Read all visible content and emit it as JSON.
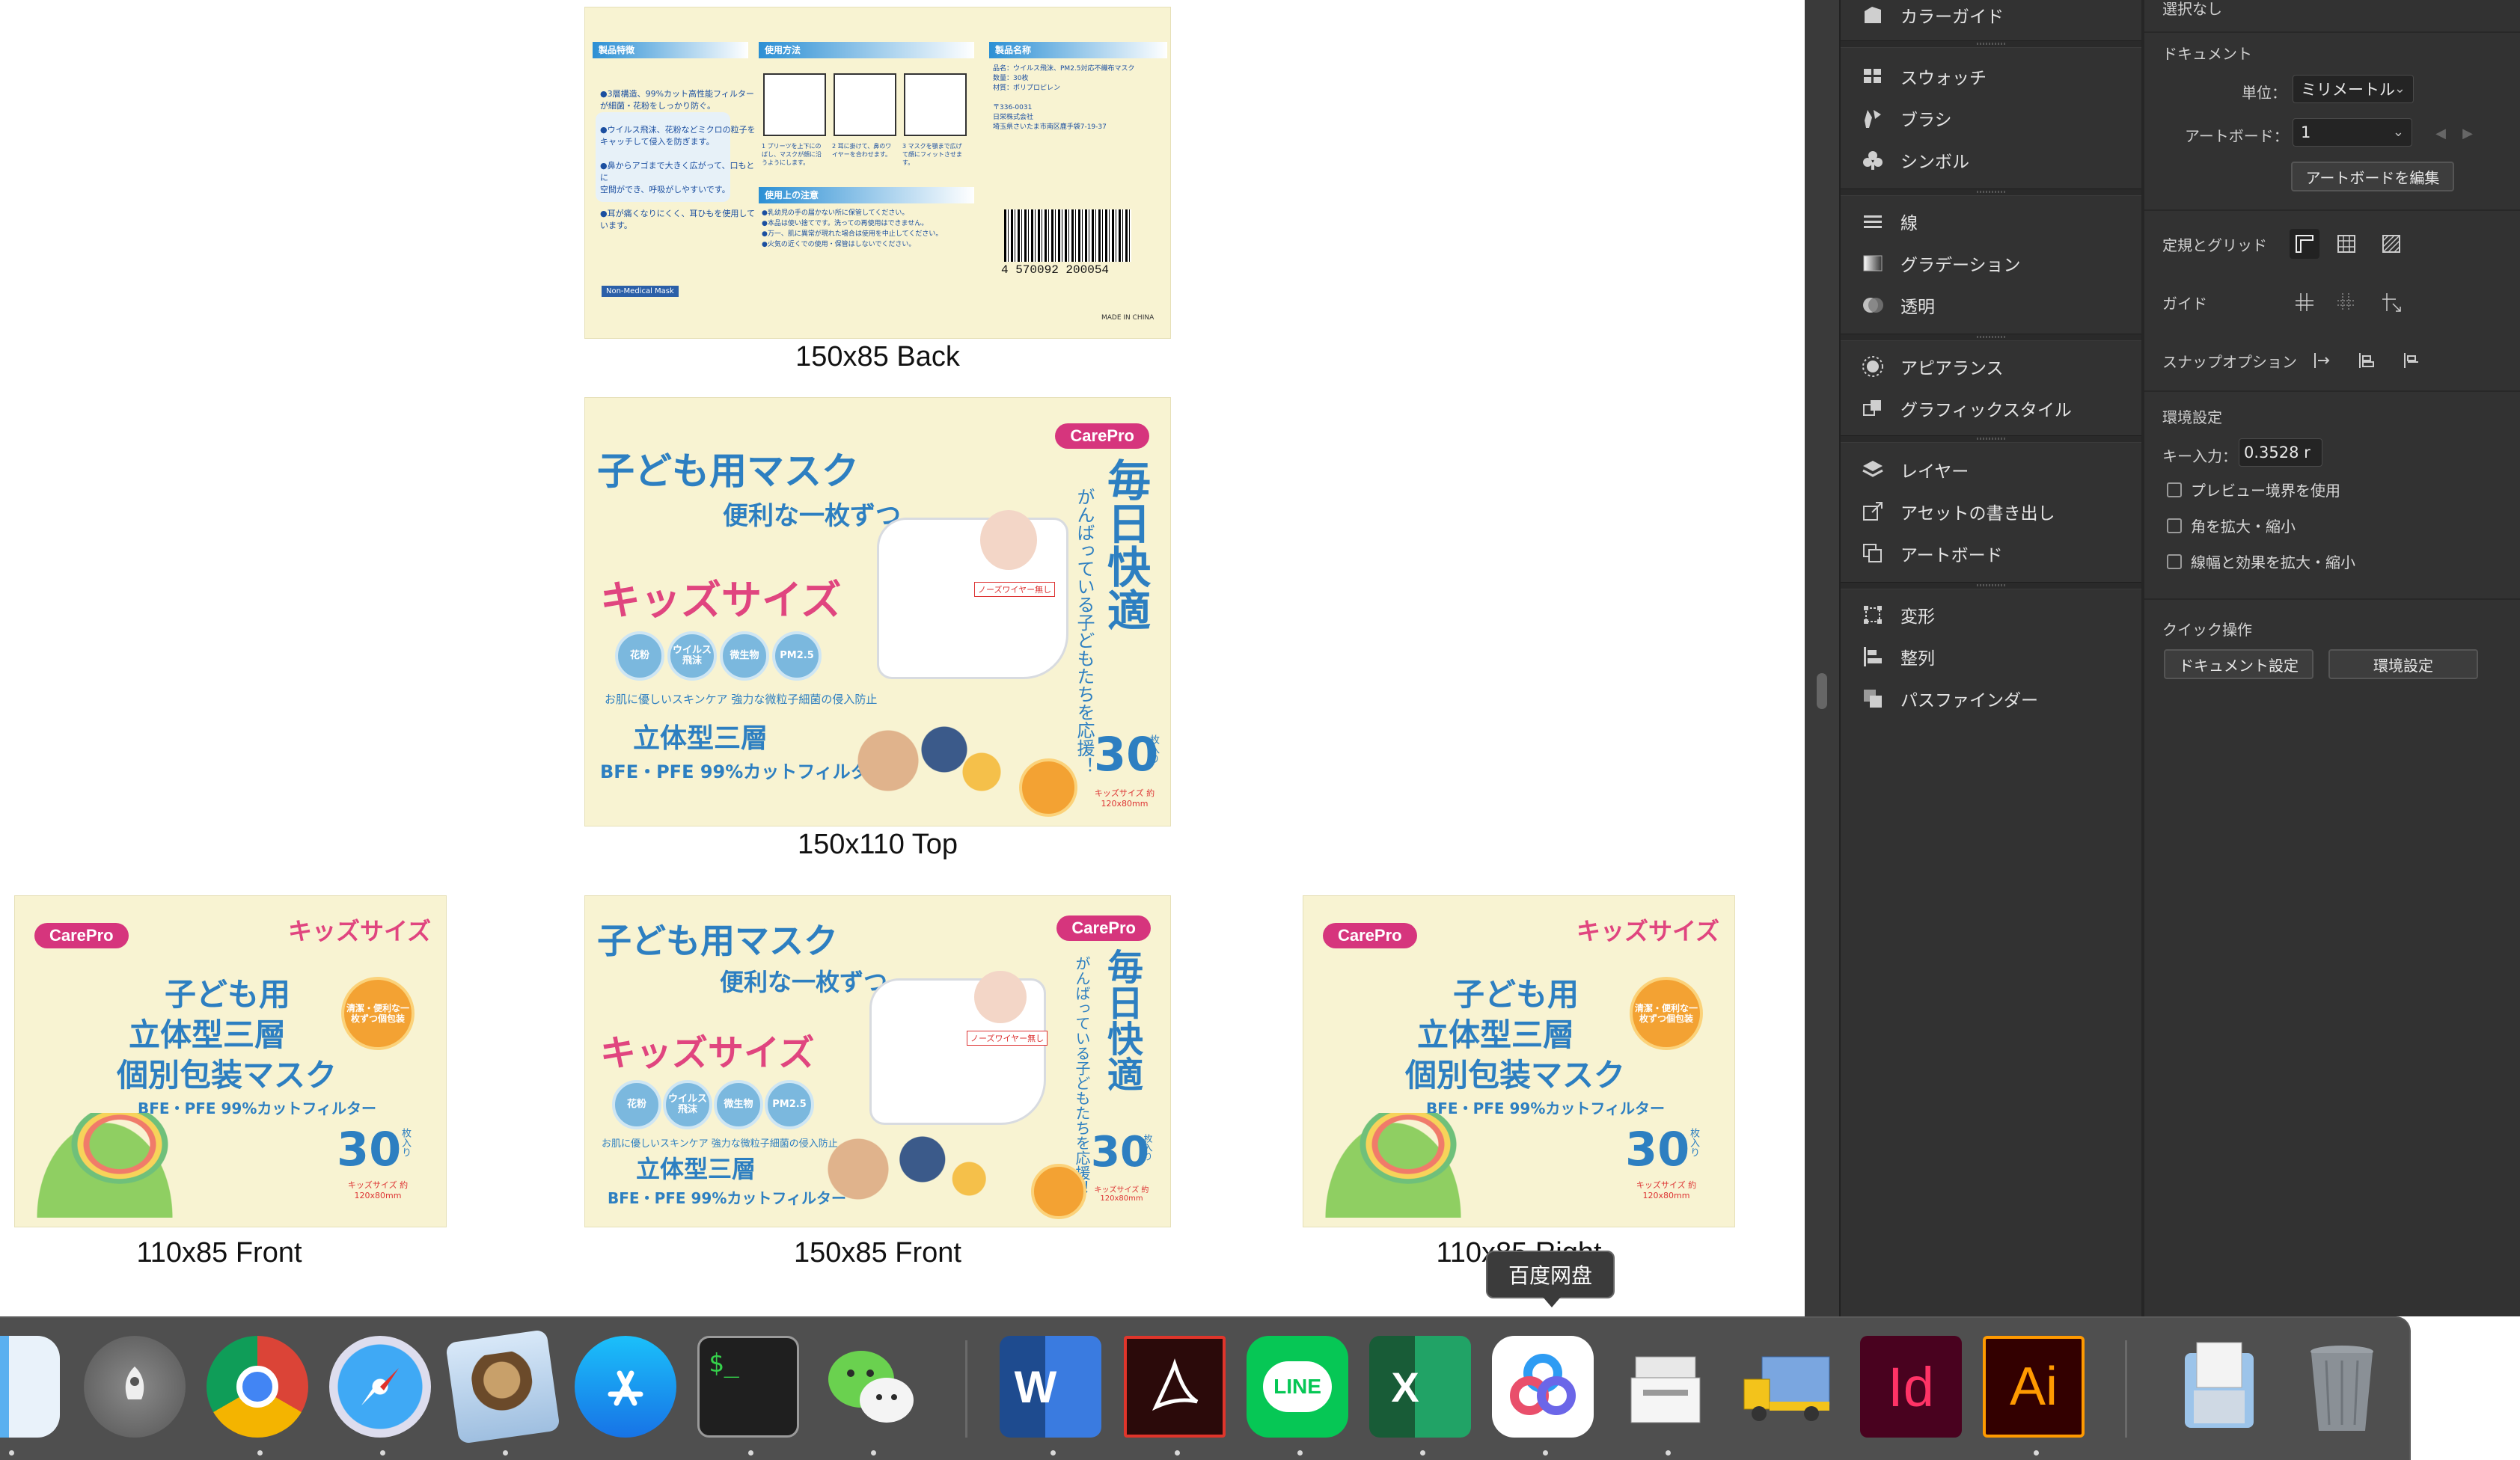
{
  "artboards": {
    "back": {
      "caption": "150x85 Back",
      "headers": [
        "製品特徴",
        "使用方法",
        "製品名称",
        "使用上の注意"
      ],
      "feature_text": "●3層構造、99%カット高性能フィルター\nが細菌・花粉をしっかり防ぐ。\n\n●ウイルス飛沫、花粉などミクロの粒子を\nキャッチして侵入を防ぎます。\n\n●鼻からアゴまで大きく広がって、口もとに\n空間ができ、呼吸がしやすいです。\n\n●耳が痛くなりにくく、耳ひもを使用して\nいます。",
      "usage_steps": [
        "1 プリーツを上下にのばし、マスクが顔に沿うようにします。",
        "2 耳に掛けて、鼻のワイヤーを合わせます。",
        "3 マスクを顎まで広げて顔にフィットさせます。"
      ],
      "product_info": "品名：ウイルス飛沫、PM2.5対応不織布マスク\n数量：30枚\n材質：ポリプロピレン\n\n〒336-0031\n日栄株式会社\n埼玉県さいたま市南区鹿手袋7-19-37",
      "caution_text": "●乳幼児の手の届かない所に保管してください。\n●本品は使い捨てです。洗っての再使用はできません。\n●万一、肌に異常が現れた場合は使用を中止してください。\n●火気の近くでの使用・保管はしないでください。",
      "barcode_number": "4 570092 200054",
      "made_in": "MADE IN CHINA",
      "tag": "Non-Medical Mask"
    },
    "top": {
      "caption": "150x110 Top",
      "brand": "CarePro",
      "title": "子ども用マスク",
      "subtitle": "便利な一枚ずつ",
      "kids_size": "キッズサイズ",
      "badges": [
        "花粉",
        "ウイルス飛沫",
        "微生物",
        "PM2.5"
      ],
      "skin_text": "お肌に優しいスキンケア 強力な微粒子細菌の侵入防止",
      "three_layer": "立体型三層",
      "filter_text": "BFE・PFE 99%カットフィルター",
      "vertical_title": "毎日快適",
      "vertical_sub": "がんばっている子どもたちを応援！",
      "count": "30",
      "count_unit": "枚入り",
      "size_note": "キッズサイズ 約120x80mm",
      "wire_note": "ノーズワイヤー無し"
    },
    "front110": {
      "caption": "110x85 Front",
      "brand": "CarePro",
      "kids_size": "キッズサイズ",
      "line1": "子ども用",
      "line2": "立体型三層",
      "line3": "個別包装マスク",
      "filter_text": "BFE・PFE 99%カットフィルター",
      "count": "30",
      "count_unit": "枚入り",
      "size_note": "キッズサイズ 約120x80mm",
      "badge_text": "清潔・便利な一枚ずつ個包装"
    },
    "front150": {
      "caption": "150x85 Front",
      "brand": "CarePro",
      "title": "子ども用マスク",
      "subtitle": "便利な一枚ずつ",
      "kids_size": "キッズサイズ",
      "badges": [
        "花粉",
        "ウイルス飛沫",
        "微生物",
        "PM2.5"
      ],
      "skin_text": "お肌に優しいスキンケア 強力な微粒子細菌の侵入防止",
      "three_layer": "立体型三層",
      "filter_text": "BFE・PFE 99%カットフィルター",
      "vertical_title": "毎日快適",
      "vertical_sub": "がんばっている子どもたちを応援！",
      "count": "30",
      "count_unit": "枚入り",
      "size_note": "キッズサイズ 約120x80mm",
      "wire_note": "ノーズワイヤー無し"
    },
    "right110": {
      "caption": "110x85 Right",
      "brand": "CarePro",
      "kids_size": "キッズサイズ",
      "line1": "子ども用",
      "line2": "立体型三層",
      "line3": "個別包装マスク",
      "filter_text": "BFE・PFE 99%カットフィルター",
      "count": "30",
      "count_unit": "枚入り",
      "size_note": "キッズサイズ 約120x80mm",
      "badge_text": "清潔・便利な一枚ずつ個包装"
    }
  },
  "panel_list": {
    "items": [
      {
        "label": "カラーガイド",
        "icon": "color-guide-icon"
      },
      {
        "label": "スウォッチ",
        "icon": "swatches-icon"
      },
      {
        "label": "ブラシ",
        "icon": "brushes-icon"
      },
      {
        "label": "シンボル",
        "icon": "symbols-icon"
      },
      {
        "label": "線",
        "icon": "stroke-icon"
      },
      {
        "label": "グラデーション",
        "icon": "gradient-icon"
      },
      {
        "label": "透明",
        "icon": "transparency-icon"
      },
      {
        "label": "アピアランス",
        "icon": "appearance-icon"
      },
      {
        "label": "グラフィックスタイル",
        "icon": "graphic-styles-icon"
      },
      {
        "label": "レイヤー",
        "icon": "layers-icon"
      },
      {
        "label": "アセットの書き出し",
        "icon": "asset-export-icon"
      },
      {
        "label": "アートボード",
        "icon": "artboards-icon"
      },
      {
        "label": "変形",
        "icon": "transform-icon"
      },
      {
        "label": "整列",
        "icon": "align-icon"
      },
      {
        "label": "パスファインダー",
        "icon": "pathfinder-icon"
      }
    ]
  },
  "properties": {
    "no_selection": "選択なし",
    "document_heading": "ドキュメント",
    "unit_label": "単位：",
    "unit_value": "ミリメートル",
    "artboard_label": "アートボード：",
    "artboard_value": "1",
    "edit_artboards": "アートボードを編集",
    "rulers_grids": "定規とグリッド",
    "guides": "ガイド",
    "snap_options": "スナップオプション",
    "preferences_heading": "環境設定",
    "key_input_label": "キー入力：",
    "key_input_value": "0.3528 r",
    "checkboxes": [
      "プレビュー境界を使用",
      "角を拡大・縮小",
      "線幅と効果を拡大・縮小"
    ],
    "quick_actions": "クイック操作",
    "document_setup": "ドキュメント設定",
    "preferences_button": "環境設定"
  },
  "dock": {
    "tooltip": "百度网盘",
    "apps": [
      "Finder",
      "Launchpad",
      "Chrome",
      "Safari",
      "Mail",
      "App Store",
      "Terminal",
      "WeChat",
      "Word",
      "Acrobat",
      "LINE",
      "Excel",
      "百度网盘",
      "Printer",
      "Transmit",
      "InDesign",
      "Illustrator",
      "Downloads",
      "Trash"
    ],
    "terminal_glyph": "$_",
    "word_glyph": "W",
    "excel_glyph": "X",
    "line_glyph": "LINE",
    "indesign_glyph": "Id",
    "illustrator_glyph": "Ai",
    "colors": {
      "word": "#2b579a",
      "excel": "#217346",
      "line": "#06c755",
      "indesign": "#49021f",
      "illustrator": "#330000",
      "acrobat": "#2b0a0a"
    }
  }
}
